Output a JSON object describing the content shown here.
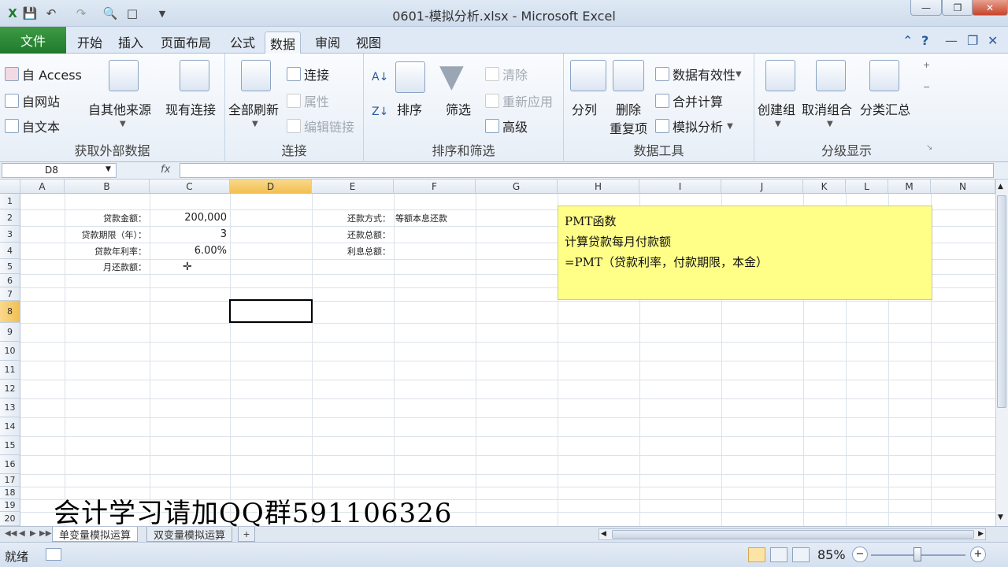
{
  "window": {
    "title": "0601-模拟分析.xlsx - Microsoft Excel"
  },
  "menu_tabs": [
    "文件",
    "开始",
    "插入",
    "页面布局",
    "公式",
    "数据",
    "审阅",
    "视图"
  ],
  "active_tab": "数据",
  "ribbon": {
    "get_external": {
      "access": "自 Access",
      "web": "自网站",
      "text": "自文本",
      "other": "自其他来源",
      "existing": "现有连接",
      "group": "获取外部数据"
    },
    "connections": {
      "refresh_all": "全部刷新",
      "connections": "连接",
      "properties": "属性",
      "edit_links": "编辑链接",
      "group": "连接"
    },
    "sort_filter": {
      "sort": "排序",
      "filter": "筛选",
      "clear": "清除",
      "reapply": "重新应用",
      "advanced": "高级",
      "group": "排序和筛选"
    },
    "data_tools": {
      "text_to_columns": "分列",
      "remove_dup_1": "删除",
      "remove_dup_2": "重复项",
      "validation": "数据有效性",
      "consolidate": "合并计算",
      "what_if": "模拟分析",
      "group": "数据工具"
    },
    "outline": {
      "group_btn": "创建组",
      "ungroup": "取消组合",
      "subtotal": "分类汇总",
      "group": "分级显示"
    }
  },
  "formula_bar": {
    "name_box": "D8",
    "fx": "fx",
    "content": ""
  },
  "columns": [
    "A",
    "B",
    "C",
    "D",
    "E",
    "F",
    "G",
    "H",
    "I",
    "J",
    "K",
    "L",
    "M",
    "N"
  ],
  "selected_column": "D",
  "rows": [
    "1",
    "2",
    "3",
    "4",
    "5",
    "6",
    "7",
    "8",
    "9",
    "10",
    "11",
    "12",
    "13",
    "14",
    "15",
    "16",
    "17",
    "18",
    "19",
    "20"
  ],
  "selected_row": "8",
  "cells": {
    "B2": "贷款金额：",
    "C2": "200,000",
    "B3": "贷款期限（年）：",
    "C3": "3",
    "B4": "贷款年利率：",
    "C4": "6.00%",
    "B5": "月还款额：",
    "E2": "还款方式：",
    "F2": "等额本息还款",
    "E3": "还款总额：",
    "E4": "利息总额："
  },
  "note": {
    "line1": "PMT函数",
    "line2": "计算贷款每月付款额",
    "line3": "=PMT（贷款利率，付款期限，本金）"
  },
  "sheets": [
    "单变量模拟运算",
    "双变量模拟运算"
  ],
  "active_sheet": "单变量模拟运算",
  "status": {
    "ready": "就绪",
    "zoom": "85%"
  },
  "watermark": "会计学习请加QQ群591106326"
}
